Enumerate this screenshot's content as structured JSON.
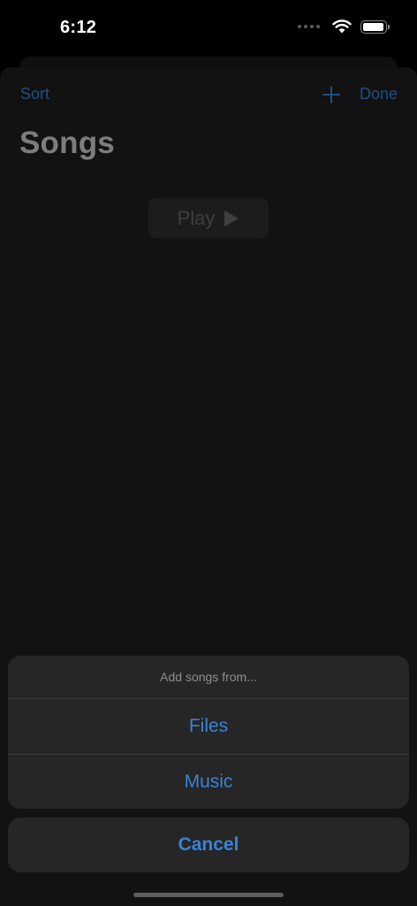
{
  "status_bar": {
    "time": "6:12"
  },
  "nav": {
    "sort_label": "Sort",
    "add_icon": "plus-icon",
    "done_label": "Done"
  },
  "page": {
    "title": "Songs",
    "play_label": "Play",
    "play_icon": "play-icon"
  },
  "action_sheet": {
    "title": "Add songs from...",
    "options": [
      "Files",
      "Music"
    ],
    "cancel_label": "Cancel"
  },
  "colors": {
    "accent": "#3b82d6",
    "accent_dimmed": "#1d4f86",
    "sheet_background": "#262626",
    "background": "#121212"
  }
}
